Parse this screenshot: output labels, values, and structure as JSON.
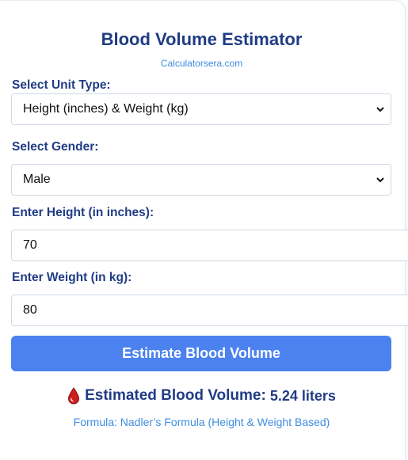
{
  "header": {
    "title": "Blood Volume Estimator",
    "subtitle": "Calculatorsera.com"
  },
  "form": {
    "unit_type_label": "Select Unit Type:",
    "unit_type_value": "Height (inches) & Weight (kg)",
    "gender_label": "Select Gender:",
    "gender_value": "Male",
    "height_label": "Enter Height (in inches):",
    "height_value": "70",
    "weight_label": "Enter Weight (in kg):",
    "weight_value": "80",
    "submit_label": "Estimate Blood Volume"
  },
  "result": {
    "icon": "blood-drop-icon",
    "label": "Estimated Blood Volume:",
    "value": "5.24 liters",
    "formula_text": "Formula: Nadler’s Formula (Height & Weight Based)"
  },
  "colors": {
    "heading": "#213c85",
    "link": "#3e8de0",
    "button": "#4b82f0",
    "drop": "#cc1f1f"
  }
}
